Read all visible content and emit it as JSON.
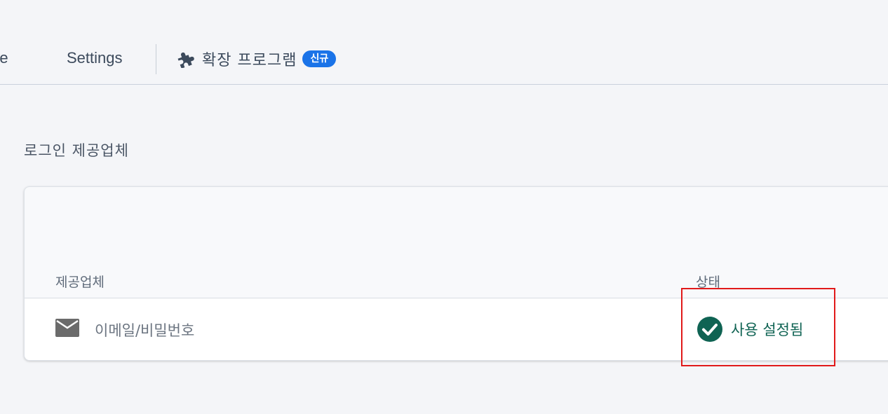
{
  "tabs": {
    "usage_label": "Usage",
    "settings_label": "Settings",
    "extensions_label": "확장 프로그램",
    "extensions_badge": "신규"
  },
  "section": {
    "title": "로그인 제공업체"
  },
  "table": {
    "columns": {
      "provider": "제공업체",
      "status": "상태"
    },
    "rows": [
      {
        "provider": "이메일/비밀번호",
        "icon": "mail-icon",
        "status": "사용 설정됨",
        "status_icon": "check-circle-icon"
      }
    ]
  },
  "colors": {
    "badge": "#1a73e8",
    "status_ok": "#0f6353",
    "highlight": "#e11a1a"
  }
}
